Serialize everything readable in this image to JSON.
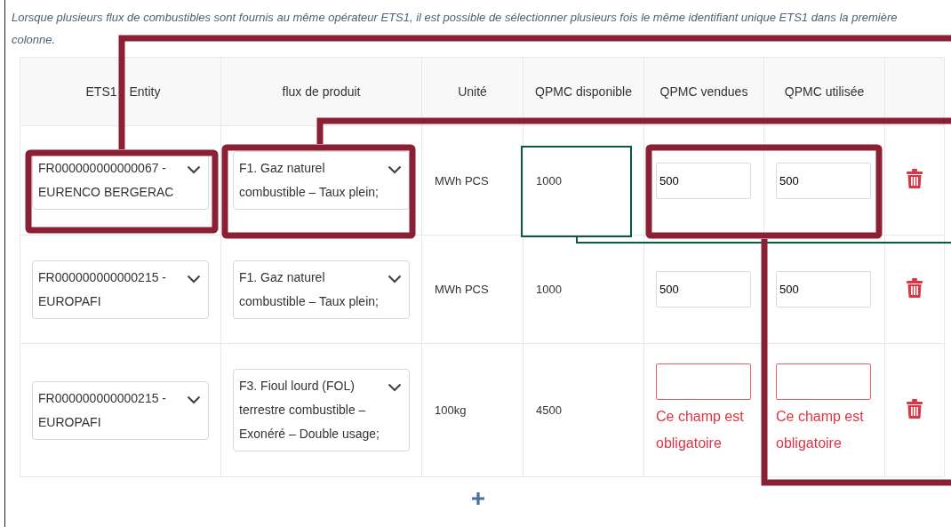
{
  "note": "Lorsque plusieurs flux de combustibles sont fournis au même opérateur ETS1, il est possible de sélectionner plusieurs fois le même identifiant unique ETS1 dans la première colonne.",
  "table": {
    "columns": [
      "ETS1 Entity",
      "flux de produit",
      "Unité",
      "QPMC disponible",
      "QPMC vendues",
      "QPMC utilisée"
    ],
    "rows": [
      {
        "entity": "FR000000000000067 - EURENCO BERGERAC",
        "flux": "F1. Gaz naturel combustible – Taux plein;",
        "unit": "MWh PCS",
        "available": "1000",
        "sold": {
          "value": "500",
          "invalid": false
        },
        "used": {
          "value": "500",
          "invalid": false
        }
      },
      {
        "entity": "FR000000000000215 - EUROPAFI",
        "flux": "F1. Gaz naturel combustible – Taux plein;",
        "unit": "MWh PCS",
        "available": "1000",
        "sold": {
          "value": "500",
          "invalid": false
        },
        "used": {
          "value": "500",
          "invalid": false
        }
      },
      {
        "entity": "FR000000000000215 - EUROPAFI",
        "flux": "F3. Fioul lourd (FOL) terrestre combustible – Exonéré – Double usage;",
        "unit": "100kg",
        "available": "4500",
        "sold": {
          "invalid": true,
          "error": "Ce champ est obligatoire"
        },
        "used": {
          "invalid": true,
          "error": "Ce champ est obligatoire"
        }
      }
    ]
  }
}
